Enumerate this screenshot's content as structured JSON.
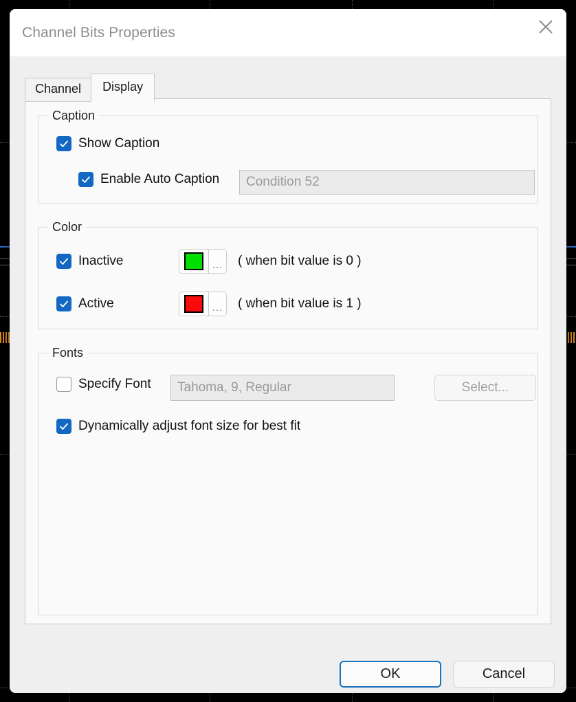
{
  "window": {
    "title": "Channel Bits Properties",
    "close_icon": "close-x-icon"
  },
  "tabs": [
    {
      "label": "Channel",
      "selected": false
    },
    {
      "label": "Display",
      "selected": true
    }
  ],
  "groups": {
    "caption": {
      "legend": "Caption",
      "show_caption": {
        "label": "Show Caption",
        "checked": true
      },
      "enable_auto_caption": {
        "label": "Enable Auto Caption",
        "checked": true
      },
      "caption_value": "Condition 52"
    },
    "color": {
      "legend": "Color",
      "inactive": {
        "label": "Inactive",
        "checked": true,
        "swatch": "#00E000",
        "ellipsis": "...",
        "hint": "( when bit value is 0 )"
      },
      "active": {
        "label": "Active",
        "checked": true,
        "swatch": "#FA0A0A",
        "ellipsis": "...",
        "hint": "( when bit value is 1 )"
      }
    },
    "fonts": {
      "legend": "Fonts",
      "specify_font": {
        "label": "Specify Font",
        "checked": false
      },
      "font_value": "Tahoma, 9, Regular",
      "select_button": "Select...",
      "dynamic_fit": {
        "label": "Dynamically adjust font size for best fit",
        "checked": true
      }
    }
  },
  "footer": {
    "ok_label": "OK",
    "cancel_label": "Cancel"
  },
  "theme": {
    "accent": "#1268c3",
    "focus_border": "#1a72b8",
    "dialog_bg": "#efefef",
    "panel_bg": "#fafafa",
    "title_color": "#8d8d8d",
    "backdrop": "#000000"
  }
}
